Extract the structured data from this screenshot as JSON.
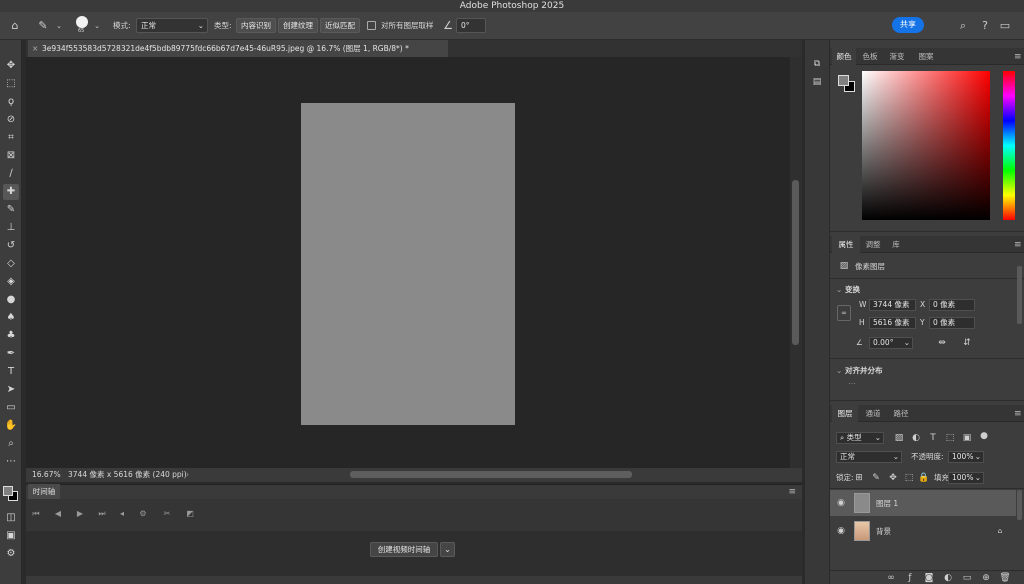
{
  "app": {
    "title": "Adobe Photoshop 2025"
  },
  "options_bar": {
    "brush_size": "65",
    "mode_label": "模式:",
    "mode_value": "正常",
    "type_label": "类型:",
    "type_buttons": [
      "内容识别",
      "创建纹理",
      "近似匹配"
    ],
    "sample_all_label": "对所有图层取样",
    "angle_value": "0°",
    "share_label": "共享"
  },
  "document": {
    "tab_title": "3e934f553583d5728321de4f5bdb89775fdc66b67d7e45-46uR95.jpeg @ 16.7% (图层 1, RGB/8*) *",
    "background_color": "#8a8a8a"
  },
  "status_bar": {
    "zoom": "16.67%",
    "info": "3744 像素 x 5616 像素 (240 ppi)"
  },
  "timeline": {
    "tab_label": "时间轴",
    "create_button": "创建视频时间轴"
  },
  "color_panel": {
    "tabs": [
      "颜色",
      "色板",
      "渐变",
      "图案"
    ],
    "fg": "#808080",
    "bg": "#000000"
  },
  "properties_panel": {
    "tabs": [
      "属性",
      "调整",
      "库"
    ],
    "layer_type": "像素图层",
    "transform_title": "变换",
    "w_label": "W",
    "w_value": "3744 像素",
    "h_label": "H",
    "h_value": "5616 像素",
    "x_label": "X",
    "x_value": "0 像素",
    "y_label": "Y",
    "y_value": "0 像素",
    "angle_value": "0.00°",
    "align_title": "对齐并分布"
  },
  "layers_panel": {
    "tabs": [
      "图层",
      "通道",
      "路径"
    ],
    "filter_kind": "类型",
    "blend_mode": "正常",
    "opacity_label": "不透明度:",
    "opacity_value": "100%",
    "lock_label": "锁定:",
    "fill_label": "填充:",
    "fill_value": "100%",
    "layers": [
      {
        "name": "图层 1",
        "selected": true
      },
      {
        "name": "背景",
        "selected": false,
        "locked": true
      }
    ]
  }
}
